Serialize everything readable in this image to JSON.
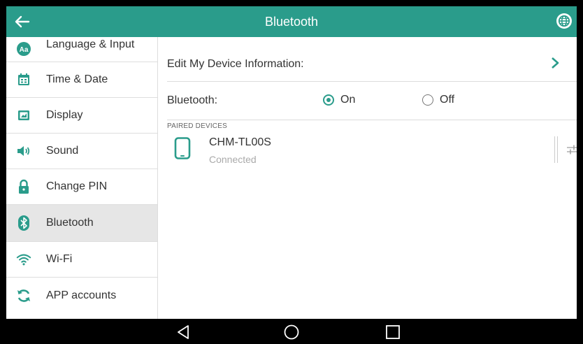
{
  "header": {
    "title": "Bluetooth",
    "back_icon": "arrow-left-icon",
    "globe_icon": "globe-icon",
    "accent": "#2a9c8b"
  },
  "sidebar": {
    "items": [
      {
        "label": "Language & Input",
        "icon": "language-icon",
        "active": false
      },
      {
        "label": "Time & Date",
        "icon": "calendar-icon",
        "active": false
      },
      {
        "label": "Display",
        "icon": "display-icon",
        "active": false
      },
      {
        "label": "Sound",
        "icon": "speaker-icon",
        "active": false
      },
      {
        "label": "Change PIN",
        "icon": "lock-icon",
        "active": false
      },
      {
        "label": "Bluetooth",
        "icon": "bluetooth-icon",
        "active": true
      },
      {
        "label": "Wi-Fi",
        "icon": "wifi-icon",
        "active": false
      },
      {
        "label": "APP accounts",
        "icon": "sync-icon",
        "active": false
      }
    ]
  },
  "main": {
    "edit_device": {
      "label": "Edit My Device Information:"
    },
    "bluetooth": {
      "label": "Bluetooth:",
      "options": [
        {
          "label": "On",
          "selected": true
        },
        {
          "label": "Off",
          "selected": false
        }
      ]
    },
    "paired_section_label": "PAIRED DEVICES",
    "paired_devices": [
      {
        "name": "CHM-TL00S",
        "status": "Connected"
      }
    ]
  },
  "navbar": {
    "buttons": [
      "back-triangle-icon",
      "home-circle-icon",
      "recents-square-icon"
    ]
  }
}
